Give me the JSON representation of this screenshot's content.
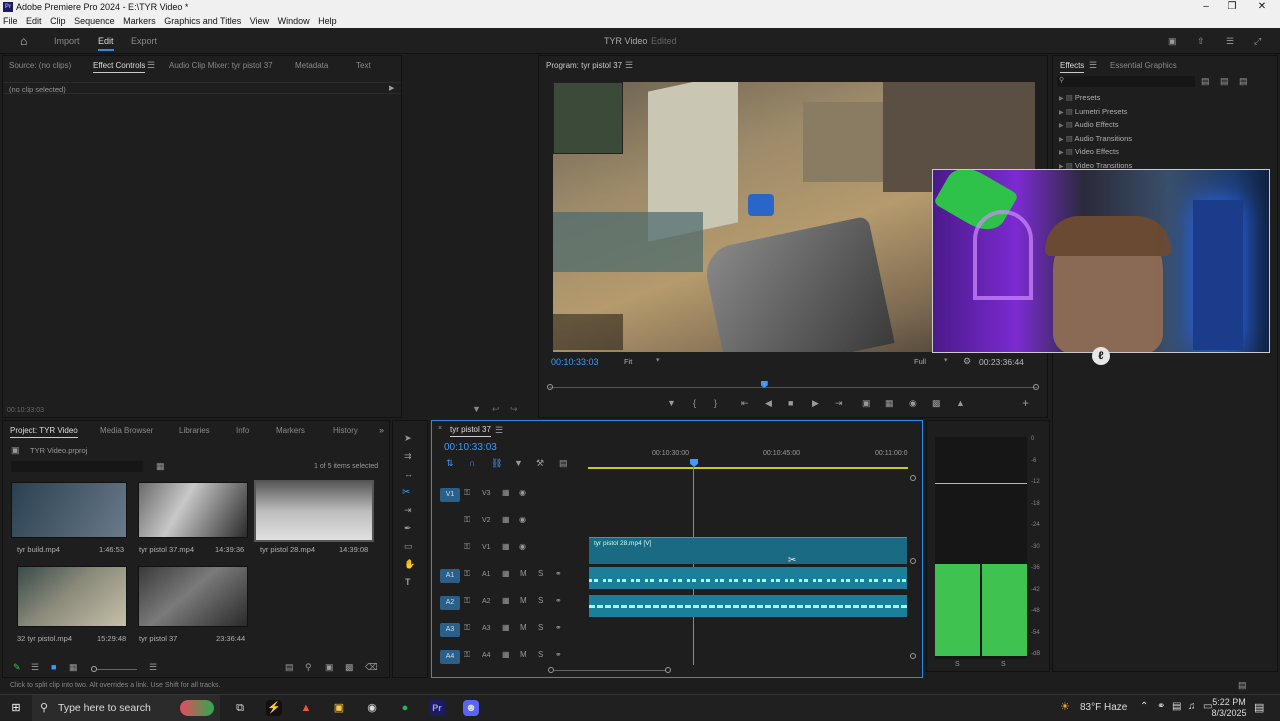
{
  "window": {
    "title": "Adobe Premiere Pro 2024 - E:\\TYR Video *",
    "logo": "Pr"
  },
  "menu": [
    "File",
    "Edit",
    "Clip",
    "Sequence",
    "Markers",
    "Graphics and Titles",
    "View",
    "Window",
    "Help"
  ],
  "workspace": {
    "tabs": [
      "Import",
      "Edit",
      "Export"
    ],
    "active": "Edit",
    "project_title": "TYR Video",
    "status": "Edited"
  },
  "source_panel": {
    "tabs": [
      "Source: (no clips)",
      "Effect Controls",
      "Audio Clip Mixer: tyr pistol 37",
      "Metadata",
      "Text"
    ],
    "active": "Effect Controls",
    "no_clip": "(no clip selected)",
    "timecode": "00:10:33:03"
  },
  "program": {
    "title": "Program: tyr pistol 37",
    "timecode": "00:10:33:03",
    "fit": "Fit",
    "quality": "Full",
    "duration": "00:23:36:44",
    "playhead_fraction": 0.44
  },
  "effects_panel": {
    "tabs": [
      "Effects",
      "Essential Graphics"
    ],
    "active": "Effects",
    "items": [
      "Presets",
      "Lumetri Presets",
      "Audio Effects",
      "Audio Transitions",
      "Video Effects",
      "Video Transitions"
    ]
  },
  "project": {
    "tabs": [
      "Project: TYR Video",
      "Media Browser",
      "Libraries",
      "Info",
      "Markers",
      "History"
    ],
    "active": "Project: TYR Video",
    "file": "TYR Video.prproj",
    "selection": "1 of 5 items selected",
    "items": [
      {
        "name": "tyr build.mp4",
        "duration": "1:46:53"
      },
      {
        "name": "tyr pistol 37.mp4",
        "duration": "14:39:36"
      },
      {
        "name": "tyr pistol 28.mp4",
        "duration": "14:39:08"
      },
      {
        "name": "32 tyr pistol.mp4",
        "duration": "15:29:48"
      },
      {
        "name": "tyr pistol 37",
        "duration": "23:36:44"
      }
    ]
  },
  "timeline": {
    "sequence": "tyr pistol 37",
    "timecode": "00:10:33:03",
    "ruler": [
      "00:10:30:00",
      "00:10:45:00",
      "00:11:00:0"
    ],
    "tracks": [
      {
        "id": "V3",
        "src": "V1",
        "type": "video"
      },
      {
        "id": "V2",
        "src": "",
        "type": "video"
      },
      {
        "id": "V1",
        "src": "",
        "type": "video"
      },
      {
        "id": "A1",
        "src": "A1",
        "type": "audio"
      },
      {
        "id": "A2",
        "src": "A2",
        "type": "audio"
      },
      {
        "id": "A3",
        "src": "A3",
        "type": "audio"
      },
      {
        "id": "A4",
        "src": "A4",
        "type": "audio"
      }
    ],
    "clip_label": "tyr pistol 28.mp4 [V]",
    "audio_M": "M",
    "audio_S": "S"
  },
  "meter": {
    "scale": [
      "0",
      "-6",
      "-12",
      "-18",
      "-24",
      "-30",
      "-36",
      "-42",
      "-48",
      "-54",
      "-dB"
    ],
    "channels": [
      "S",
      "S"
    ]
  },
  "status_bar": "Click to split clip into two. Alt overrides a link. Use Shift for all tracks.",
  "taskbar": {
    "search": "Type here to search",
    "weather": "83°F  Haze",
    "time": "5:22 PM",
    "date": "8/3/2025"
  },
  "colors": {
    "accent": "#2d8ceb",
    "clip": "#1a6a83",
    "audio_clip": "#1b7f9b",
    "meter": "#3fc24f"
  }
}
